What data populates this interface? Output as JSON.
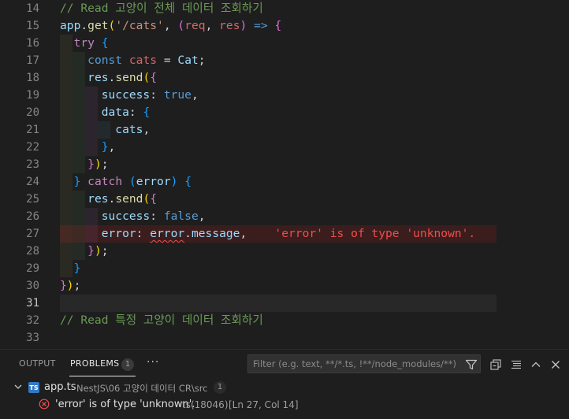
{
  "editor": {
    "error_message_inline": "'error' is of type 'unknown'.",
    "active_line": "31",
    "lines": [
      {
        "n": "14"
      },
      {
        "n": "15"
      },
      {
        "n": "16"
      },
      {
        "n": "17"
      },
      {
        "n": "18"
      },
      {
        "n": "19"
      },
      {
        "n": "20"
      },
      {
        "n": "21"
      },
      {
        "n": "22"
      },
      {
        "n": "23"
      },
      {
        "n": "24"
      },
      {
        "n": "25"
      },
      {
        "n": "26"
      },
      {
        "n": "27"
      },
      {
        "n": "28"
      },
      {
        "n": "29"
      },
      {
        "n": "30"
      },
      {
        "n": "31"
      },
      {
        "n": "32"
      },
      {
        "n": "33"
      }
    ],
    "text": {
      "l14_comment": "// Read 고양이 전체 데이터 조회하기",
      "l32_comment": "// Read 특정 고양이 데이터 조회하기",
      "app": "app",
      "get": "get",
      "route": "'/cats'",
      "req": "req",
      "res": "res",
      "try": "try",
      "const": "const",
      "cats": "cats",
      "Cat": "Cat",
      "send": "send",
      "success": "success",
      "true": "true",
      "false": "false",
      "data": "data",
      "catch": "catch",
      "error": "error",
      "message": "message"
    }
  },
  "panel": {
    "tabs": [
      {
        "label": "OUTPUT"
      },
      {
        "label": "PROBLEMS",
        "badge": "1"
      }
    ],
    "more_label": "···",
    "filter_placeholder": "Filter (e.g. text, **/*.ts, !**/node_modules/**)",
    "file": {
      "icon_label": "TS",
      "name": "app.ts",
      "path": "NestJS\\06 고양이 데이터 CR\\src",
      "count": "1"
    },
    "problem": {
      "message": "'error' is of type 'unknown'.",
      "source": "ts(18046)",
      "location": "[Ln 27, Col 14]"
    }
  },
  "colors": {
    "editor_bg": "#1e1e1e",
    "error": "#f14c4c",
    "comment": "#6a9955",
    "ts_blue": "#3178c6"
  }
}
